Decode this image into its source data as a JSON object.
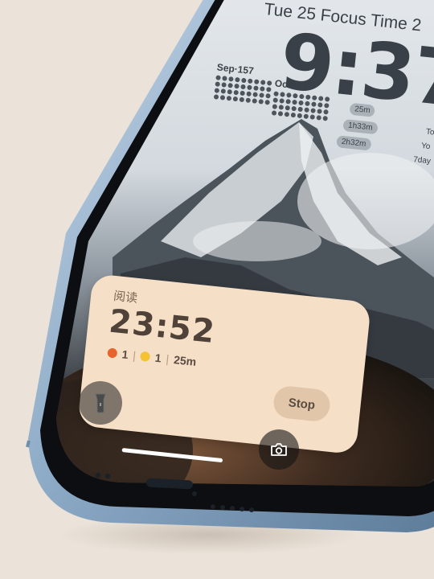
{
  "lock_screen": {
    "date_line": "Tue 25  Focus Time 2",
    "time": "9:37",
    "calendars": [
      {
        "label": "Sep·157"
      },
      {
        "label": "Oct·134"
      }
    ],
    "durations": [
      "25m",
      "1h33m",
      "2h32m"
    ],
    "side_text": [
      "To",
      "Yo",
      "7day"
    ]
  },
  "live_activity": {
    "title": "阅读",
    "timer": "23:52",
    "stats": {
      "tomato_count": "1",
      "lemon_count": "1",
      "duration": "25m"
    },
    "stop_label": "Stop"
  },
  "controls": {
    "flashlight_icon": "flashlight-icon",
    "camera_icon": "camera-icon"
  },
  "colors": {
    "background": "#ebe3da",
    "phone_frame": "#7f9fbd",
    "activity_card": "#f6dfc7",
    "stop_button": "#e2c6a9",
    "clock_text": "#3a4047"
  }
}
